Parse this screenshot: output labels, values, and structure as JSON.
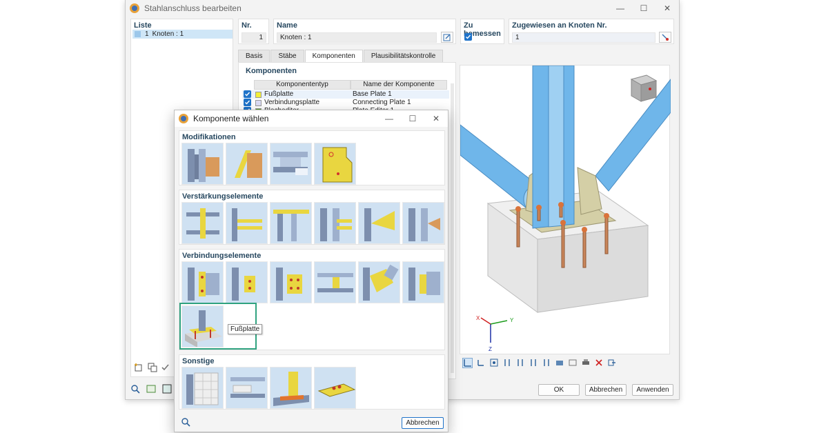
{
  "main_window": {
    "title": "Stahlanschluss bearbeiten",
    "list": {
      "label": "Liste",
      "items": [
        {
          "number": "1",
          "label": "Knoten : 1"
        }
      ]
    },
    "fields": {
      "nr_label": "Nr.",
      "nr_value": "1",
      "name_label": "Name",
      "name_value": "Knoten : 1",
      "zu_bemessen_label": "Zu bemessen",
      "zugewiesen_label": "Zugewiesen an Knoten Nr.",
      "zugewiesen_value": "1"
    },
    "tabs": [
      "Basis",
      "Stäbe",
      "Komponenten",
      "Plausibilitätskontrolle"
    ],
    "active_tab": "Komponenten",
    "komponenten": {
      "label": "Komponenten",
      "col_type": "Komponententyp",
      "col_name": "Name der Komponente",
      "rows": [
        {
          "type": "Fußplatte",
          "name": "Base Plate 1",
          "color": "#f2ef3a"
        },
        {
          "type": "Verbindungsplatte",
          "name": "Connecting Plate 1",
          "color": "#dcdcf5"
        },
        {
          "type": "Blecheditor",
          "name": "Plate Editor 1",
          "color": "#5aa02c"
        }
      ]
    },
    "buttons": {
      "ok": "OK",
      "abbrechen": "Abbrechen",
      "anwenden": "Anwenden"
    },
    "axes": {
      "x": "X",
      "y": "Y",
      "z": "Z"
    }
  },
  "dialog": {
    "title": "Komponente wählen",
    "sections": [
      {
        "label": "Modifikationen"
      },
      {
        "label": "Verstärkungselemente"
      },
      {
        "label": "Verbindungselemente"
      },
      {
        "label": "Sonstige"
      }
    ],
    "tooltip": "Fußplatte",
    "cancel_button": "Abbrechen"
  },
  "colors": {
    "accent": "#1f73c9",
    "group_label": "#26475f",
    "highlight_frame": "#2fa27f",
    "steel": "#6fb6ea",
    "plate": "#d4cfa6"
  }
}
